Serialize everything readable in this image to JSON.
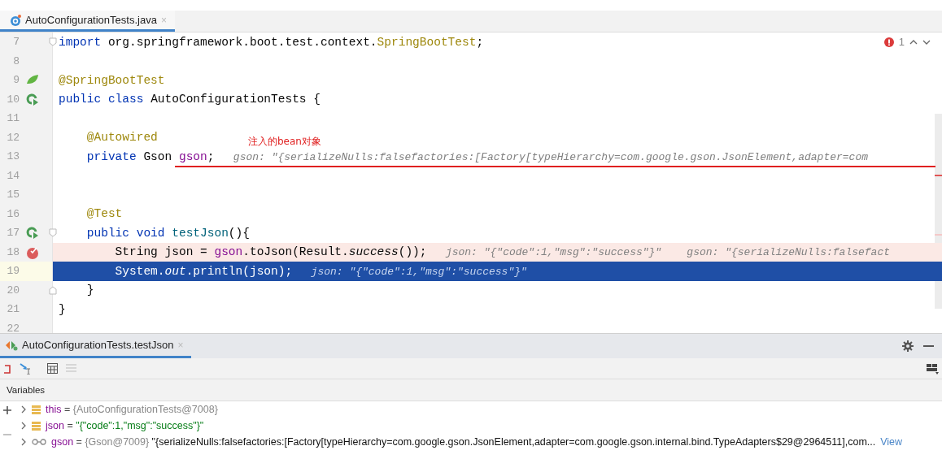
{
  "editor_tab": {
    "label": "AutoConfigurationTests.java",
    "close": "×",
    "selected": true
  },
  "problems": {
    "count": "1"
  },
  "lines": [
    {
      "number": "7",
      "kind": "plain",
      "breakpoint": false,
      "current": false,
      "tokens": [
        {
          "kind": "kw",
          "t": "import "
        },
        {
          "kind": "plain",
          "t": "org.springframework.boot.test.context."
        },
        {
          "kind": "ann",
          "t": "SpringBootTest"
        },
        {
          "kind": "plain",
          "t": ";"
        }
      ]
    },
    {
      "number": "8",
      "kind": "plain",
      "breakpoint": false,
      "current": false
    },
    {
      "number": "9",
      "kind": "leaf",
      "breakpoint": false,
      "current": false,
      "tokens": [
        {
          "kind": "ann",
          "t": "@SpringBootTest"
        }
      ]
    },
    {
      "number": "10",
      "kind": "run",
      "breakpoint": false,
      "current": false,
      "tokens": [
        {
          "kind": "kw",
          "t": "public class "
        },
        {
          "kind": "plain",
          "t": "AutoConfigurationTests {"
        }
      ]
    },
    {
      "number": "11",
      "kind": "plain",
      "breakpoint": false,
      "current": false
    },
    {
      "number": "12",
      "kind": "plain",
      "breakpoint": false,
      "current": false,
      "tokens": [
        {
          "kind": "ann",
          "t": "    @Autowired"
        }
      ]
    },
    {
      "number": "13",
      "kind": "plain",
      "breakpoint": false,
      "current": false,
      "note": "注入的bean对象",
      "tokens": [
        {
          "kind": "kw",
          "t": "    private "
        },
        {
          "kind": "plain",
          "t": "Gson "
        },
        {
          "kind": "field",
          "t": "gson"
        },
        {
          "kind": "plain",
          "t": ";"
        },
        {
          "kind": "hint",
          "t": "   gson: \"{serializeNulls:falsefactories:[Factory[typeHierarchy=com.google.gson.JsonElement,adapter=com"
        }
      ]
    },
    {
      "number": "14",
      "kind": "plain",
      "breakpoint": false,
      "current": false
    },
    {
      "number": "15",
      "kind": "plain",
      "breakpoint": false,
      "current": false
    },
    {
      "number": "16",
      "kind": "plain",
      "breakpoint": false,
      "current": false,
      "tokens": [
        {
          "kind": "ann",
          "t": "    @Test"
        }
      ]
    },
    {
      "number": "17",
      "kind": "run",
      "breakpoint": false,
      "current": false,
      "tokens": [
        {
          "kind": "kw",
          "t": "    public void "
        },
        {
          "kind": "method",
          "t": "testJson"
        },
        {
          "kind": "plain",
          "t": "(){"
        }
      ]
    },
    {
      "number": "18",
      "kind": "breakpoint",
      "breakpoint": true,
      "current": false,
      "tokens": [
        {
          "kind": "plain",
          "t": "        String json = "
        },
        {
          "kind": "field",
          "t": "gson"
        },
        {
          "kind": "plain",
          "t": ".toJson(Result."
        },
        {
          "kind": "italic",
          "t": "success"
        },
        {
          "kind": "plain",
          "t": "());"
        },
        {
          "kind": "hint",
          "t": "   json: \"{\"code\":1,\"msg\":\"success\"}\"    gson: \"{serializeNulls:falsefact"
        }
      ]
    },
    {
      "number": "19",
      "kind": "plain",
      "breakpoint": false,
      "current": true,
      "tokens": [
        {
          "kind": "plain",
          "t": "        System."
        },
        {
          "kind": "italic",
          "t": "out"
        },
        {
          "kind": "plain",
          "t": ".println(json);"
        },
        {
          "kind": "hint",
          "t": "   json: \"{\"code\":1,\"msg\":\"success\"}\""
        }
      ]
    },
    {
      "number": "20",
      "kind": "plain",
      "breakpoint": false,
      "current": false,
      "tokens": [
        {
          "kind": "plain",
          "t": "    }"
        }
      ]
    },
    {
      "number": "21",
      "kind": "plain",
      "breakpoint": false,
      "current": false,
      "tokens": [
        {
          "kind": "plain",
          "t": "}"
        }
      ]
    },
    {
      "number": "22",
      "kind": "plain",
      "breakpoint": false,
      "current": false
    }
  ],
  "debug": {
    "tab": {
      "label": "AutoConfigurationTests.testJson",
      "close": "×",
      "selected": true
    },
    "section": "Variables",
    "variables": [
      {
        "kind": "field",
        "name": "this",
        "eq": "=",
        "value": "{AutoConfigurationTests@7008}"
      },
      {
        "kind": "field",
        "name": "json",
        "eq": "=",
        "value": "\"{\"code\":1,\"msg\":\"success\"}\""
      },
      {
        "kind": "watch",
        "name": "gson",
        "eq": "=",
        "value": "{Gson@7009}",
        "extra": "\"{serializeNulls:falsefactories:[Factory[typeHierarchy=com.google.gson.JsonElement,adapter=com.google.gson.internal.bind.TypeAdapters$29@2964511],com...",
        "link": "View"
      }
    ]
  }
}
